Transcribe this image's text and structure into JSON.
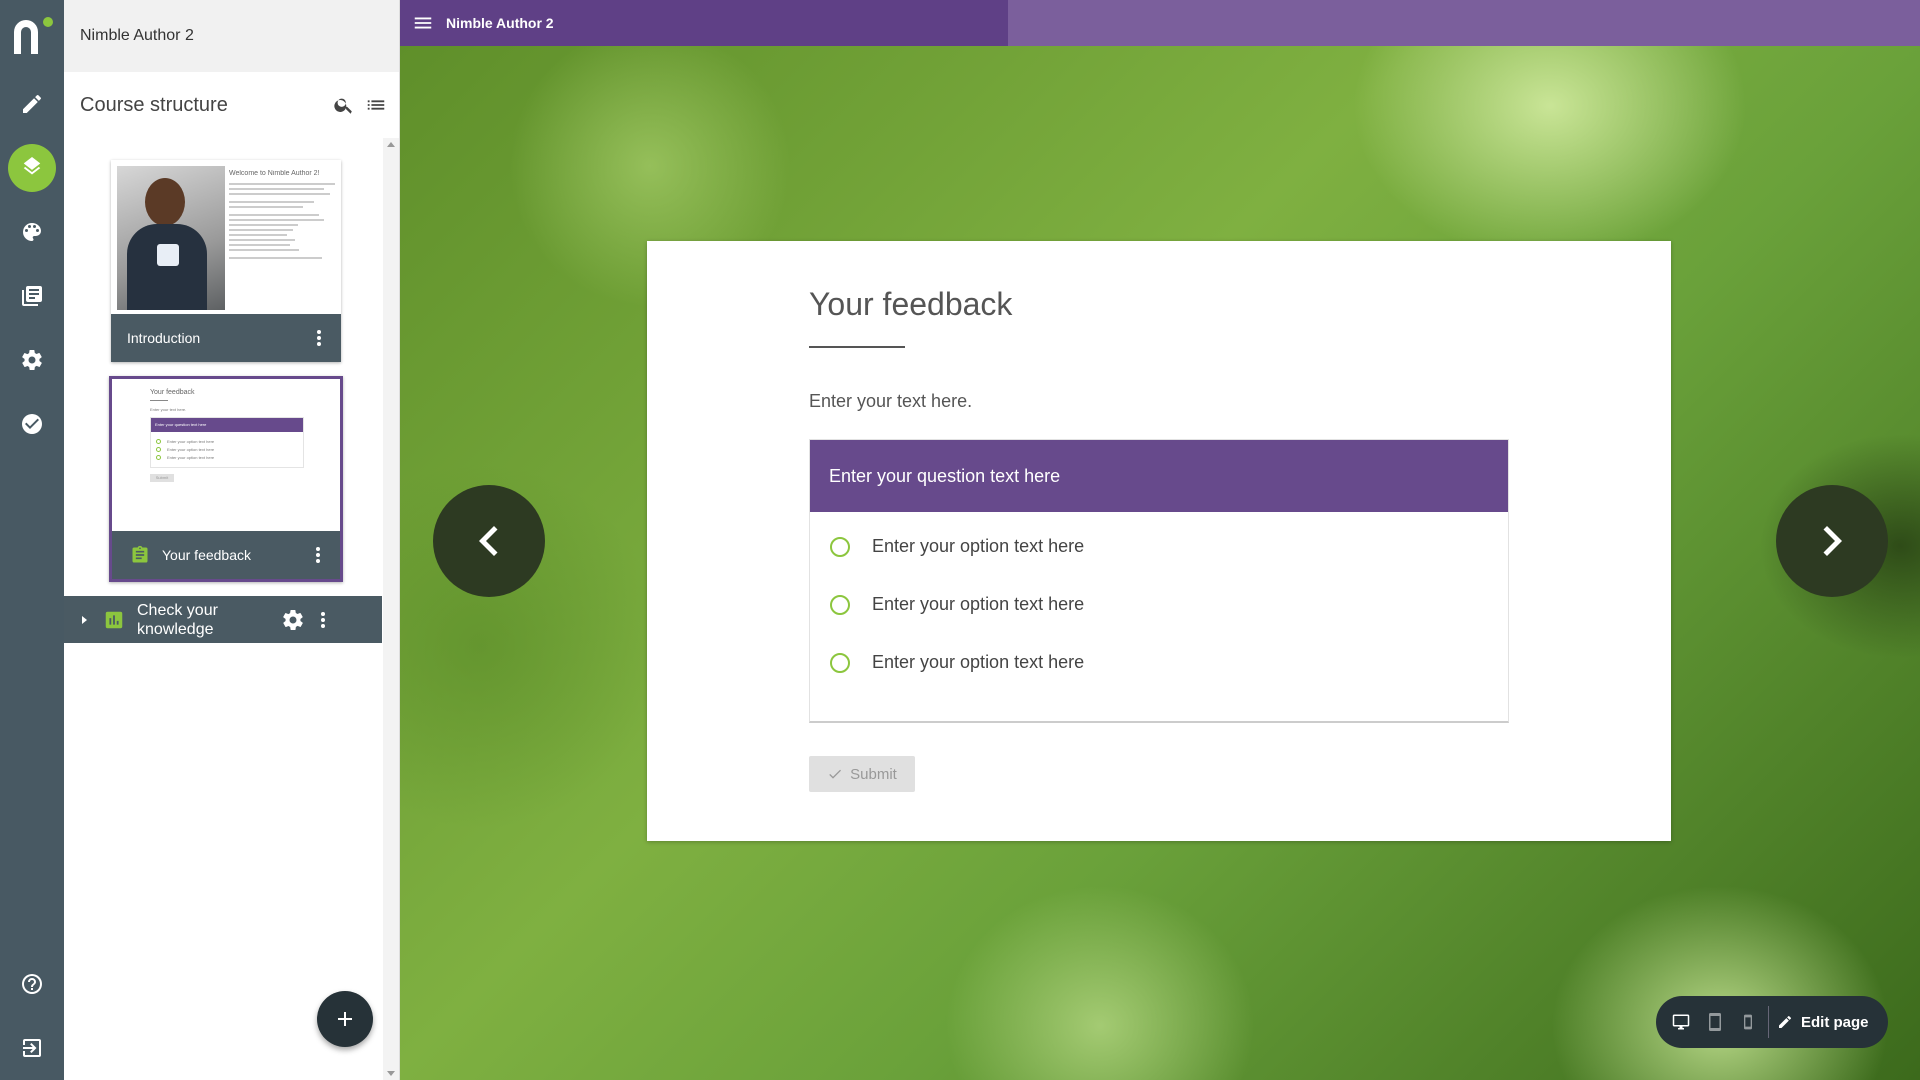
{
  "app": {
    "name": "Nimble Author 2"
  },
  "panel": {
    "title": "Course structure",
    "pages": [
      {
        "label": "Introduction",
        "thumb_title": "Welcome to Nimble Author 2!"
      },
      {
        "label": "Your feedback",
        "thumb_title": "Your feedback",
        "thumb_text": "Enter your text here.",
        "thumb_question": "Enter your question text here",
        "thumb_option": "Enter your option text here",
        "thumb_submit": "Submit"
      }
    ],
    "topic": {
      "label": "Check your knowledge"
    }
  },
  "content": {
    "title": "Your feedback",
    "text": "Enter your text here.",
    "question": "Enter your question text here",
    "options": [
      "Enter your option text here",
      "Enter your option text here",
      "Enter your option text here"
    ],
    "submit": "Submit"
  },
  "footer": {
    "edit_label": "Edit page"
  },
  "colors": {
    "rail": "#485963",
    "accent_green": "#8cc63e",
    "purple": "#674a8c"
  },
  "icons": [
    "pencil-icon",
    "layers-icon",
    "palette-icon",
    "library-icon",
    "gear-icon",
    "check-circle-icon",
    "help-icon",
    "logout-icon",
    "search-icon",
    "list-icon",
    "plus-icon",
    "chevron-left-icon",
    "chevron-right-icon",
    "desktop-icon",
    "tablet-icon",
    "phone-icon"
  ]
}
